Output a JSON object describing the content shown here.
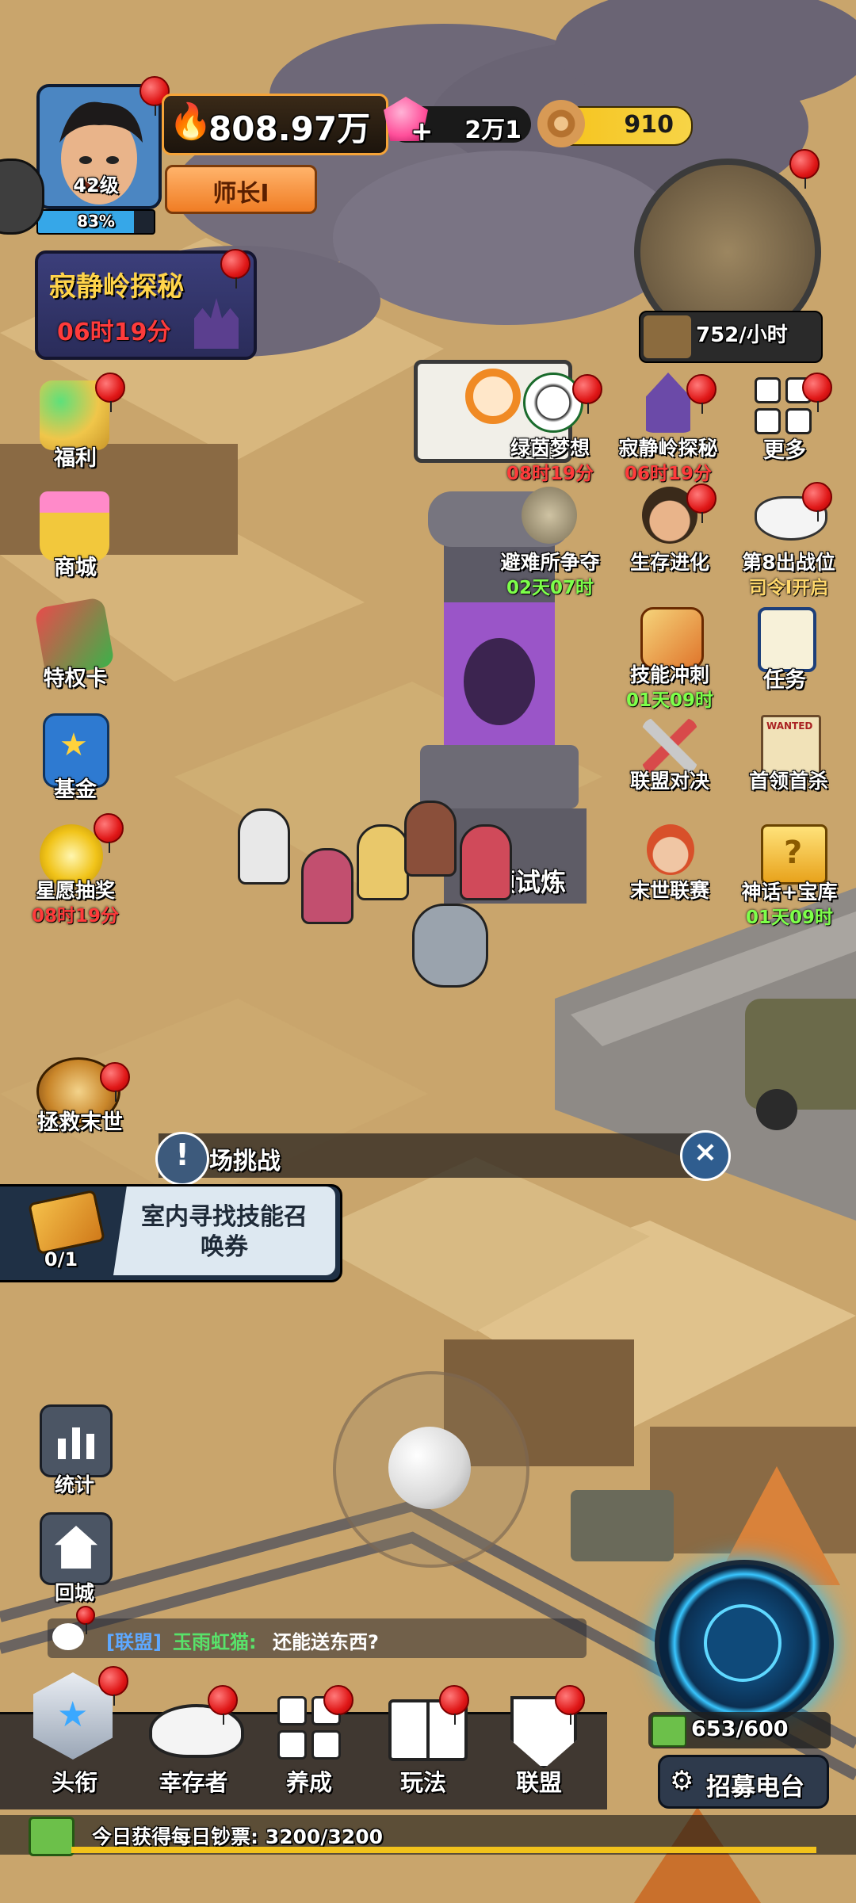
{
  "player": {
    "level": "42级",
    "exp_percent_text": "83%",
    "exp_fraction": 0.83,
    "rank": "师长Ⅰ",
    "power": "808.97万"
  },
  "currencies": {
    "gems": "2万1",
    "wood": "910"
  },
  "event_banner": {
    "title": "寂静岭探秘",
    "timer": "06时19分"
  },
  "minimap": {
    "rate": "752/小时"
  },
  "left_menu": [
    {
      "label": "福利",
      "icon": "gift-balloons-icon"
    },
    {
      "label": "商城",
      "icon": "shop-basket-icon"
    },
    {
      "label": "特权卡",
      "icon": "privilege-card-icon"
    },
    {
      "label": "基金",
      "icon": "fund-book-icon"
    },
    {
      "label": "星愿抽奖",
      "icon": "star-wish-icon",
      "timer": "08时19分"
    },
    {
      "label": "拯救末世",
      "icon": "rescue-pie-icon"
    }
  ],
  "right_menu": {
    "row1": [
      {
        "label": "绿茵梦想",
        "timer": "08时19分"
      },
      {
        "label": "寂静岭探秘",
        "timer": "06时19分"
      },
      {
        "label": "更多"
      }
    ],
    "row2": [
      {
        "label": "避难所争夺",
        "timer": "02天07时"
      },
      {
        "label": "生存进化"
      },
      {
        "label": "第8出战位",
        "timer": "司令I开启"
      }
    ],
    "row3": [
      {
        "label": "技能冲刺",
        "timer": "01天09时"
      },
      {
        "label": "任务"
      }
    ],
    "row4": [
      {
        "label": "联盟对决"
      },
      {
        "label": "首领首杀"
      }
    ],
    "row5": [
      {
        "label": "末世联赛"
      },
      {
        "label": "神话+宝库",
        "timer": "01天09时"
      }
    ]
  },
  "tower_label": "领试炼",
  "challenge": {
    "title": "场挑战",
    "task": "室内寻找技能召唤券",
    "progress": "0/1"
  },
  "side_tools": [
    {
      "label": "统计"
    },
    {
      "label": "回城"
    }
  ],
  "chat": {
    "channel": "[联盟]",
    "user": "玉雨虹猫:",
    "message": "还能送东西?"
  },
  "radar": {
    "count": "653/600",
    "recruit_label": "招募电台"
  },
  "bottom_nav": [
    {
      "label": "头衔",
      "icon": "title-star-icon"
    },
    {
      "label": "幸存者",
      "icon": "survivor-hat-icon"
    },
    {
      "label": "养成",
      "icon": "grid-squares-icon"
    },
    {
      "label": "玩法",
      "icon": "open-book-icon"
    },
    {
      "label": "联盟",
      "icon": "alliance-shield-icon"
    }
  ],
  "daily": {
    "text": "今日获得每日钞票: 3200/3200",
    "fraction": 1.0
  },
  "colors": {
    "accent_orange": "#f08a24",
    "gem_pink": "#ff4f9a",
    "timer_red": "#ff3b3b",
    "timer_green": "#7dff4a",
    "radar_blue": "#29c3ff"
  }
}
